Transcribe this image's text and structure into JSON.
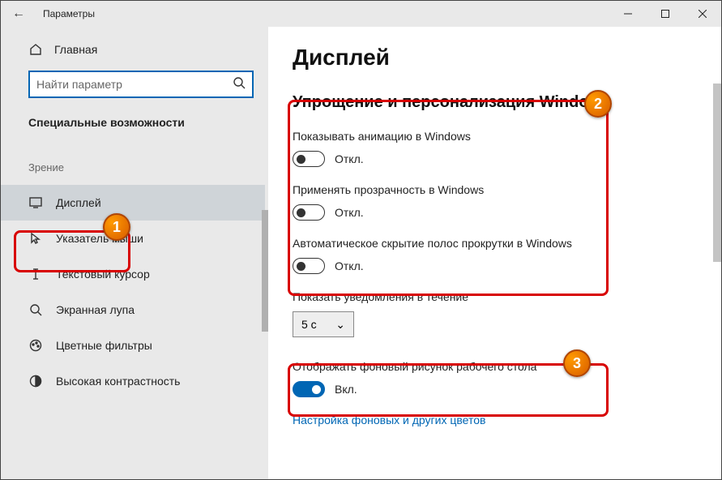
{
  "window": {
    "title": "Параметры"
  },
  "sidebar": {
    "home": "Главная",
    "search_placeholder": "Найти параметр",
    "section": "Специальные возможности",
    "group": "Зрение",
    "items": [
      {
        "label": "Дисплей"
      },
      {
        "label": "Указатель мыши"
      },
      {
        "label": "Текстовый курсор"
      },
      {
        "label": "Экранная лупа"
      },
      {
        "label": "Цветные фильтры"
      },
      {
        "label": "Высокая контрастность"
      }
    ]
  },
  "main": {
    "heading": "Дисплей",
    "subheading": "Упрощение и персонализация Windows",
    "opt_animations": "Показывать анимацию в Windows",
    "opt_transparency": "Применять прозрачность в Windows",
    "opt_scrollbars": "Автоматическое скрытие полос прокрутки в Windows",
    "opt_notifications": "Показать уведомления в течение",
    "notifications_value": "5 с",
    "opt_wallpaper": "Отображать фоновый рисунок рабочего стола",
    "state_off": "Откл.",
    "state_on": "Вкл.",
    "link_colors": "Настройка фоновых и других цветов"
  },
  "badges": {
    "b1": "1",
    "b2": "2",
    "b3": "3"
  }
}
